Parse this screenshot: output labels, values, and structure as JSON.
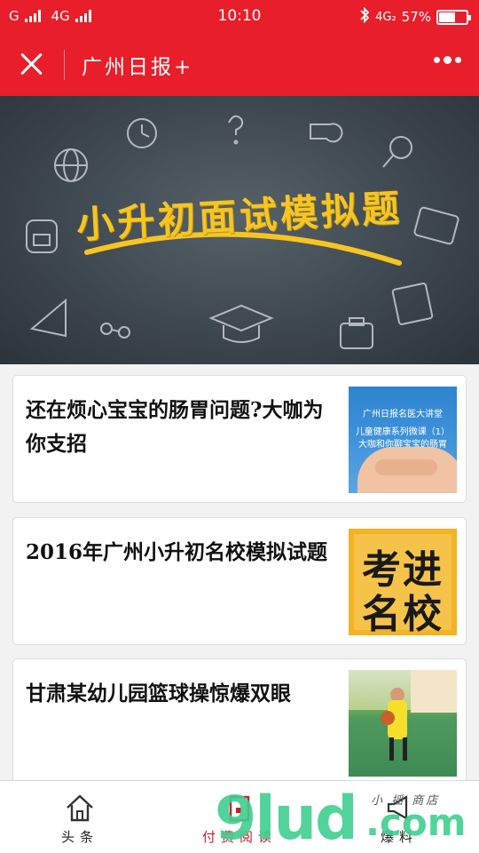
{
  "status_bar": {
    "carrier1": "G",
    "carrier2": "4G",
    "time": "10:10",
    "network": "4G₂",
    "battery": "57%",
    "icons": [
      "signal-icon",
      "bluetooth-icon",
      "battery-icon"
    ]
  },
  "nav": {
    "title": "广州日报+",
    "close_icon": "close-icon",
    "more_icon": "more-icon"
  },
  "banner": {
    "title": "小升初面试模拟题",
    "accent": "#f7c521"
  },
  "articles": [
    {
      "title": "还在烦心宝宝的肠胃问题?大咖为你支招",
      "thumb_lines": [
        "广州日报名医大讲堂",
        "儿童健康系列微课（1）",
        "大咖和你聊宝宝的肠胃"
      ]
    },
    {
      "title": "2016年广州小升初名校模拟试题",
      "thumb_lines": [
        "考进",
        "名校"
      ]
    },
    {
      "title": "甘肃某幼儿园篮球操惊爆双眼",
      "thumb_lines": []
    }
  ],
  "tabs": [
    {
      "label": "头条",
      "icon": "home-icon"
    },
    {
      "label": "付费阅读",
      "icon": "book-icon"
    },
    {
      "label": "爆料",
      "icon": "megaphone-icon"
    }
  ],
  "colors": {
    "brand": "#e81e2a",
    "banner_bg": "#3d474f"
  }
}
